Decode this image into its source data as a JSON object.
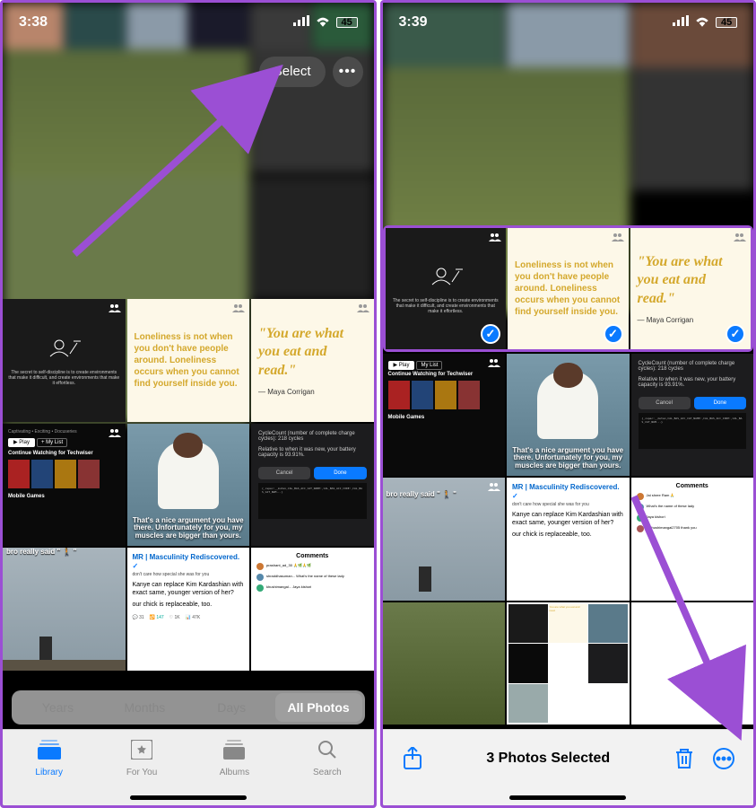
{
  "left": {
    "time": "3:38",
    "battery_level": "45",
    "controls": {
      "select": "Select",
      "more": "•••"
    },
    "quotes": {
      "q1": "Loneliness is not when you don't have people around. Loneliness occurs when you cannot find yourself inside you.",
      "q2": "\"You are what you eat and read.\"",
      "author": "— Maya Corrigan",
      "discipline": "The secret to self-discipline is to create environments that make it difficult, and create environments that make it effortless."
    },
    "cells": {
      "muscle": "That's a nice argument you have there. Unfortunately for you, my muscles are bigger than yours.",
      "cycle_t": "CycleCount (number of complete charge cycles): 218 cycles",
      "cycle_d": "Relative to when it was new, your battery capacity is 93.91%.",
      "cancel": "Cancel",
      "done": "Done",
      "nf_cat": "Captivating • Exciting • Docuseries",
      "nf_play": "▶ Play",
      "nf_mylist": "+ My List",
      "nf_cw": "Continue Watching for Techwiser",
      "nf_mg": "Mobile Games",
      "bro": "bro really said \" 🚶 \"",
      "masc": "MR | Masculinity Rediscovered.",
      "masc1": "don't care how special she was for you",
      "masc2": "Kanye can replace Kim Kardashian with exact same, younger version of her?",
      "masc3": "our chick is replaceable, too.",
      "stat1": "31",
      "stat2": "147",
      "stat3": "1K",
      "stat4": "47K",
      "comments": "Comments"
    },
    "segments": {
      "years": "Years",
      "months": "Months",
      "days": "Days",
      "all": "All Photos"
    },
    "tabs": {
      "library": "Library",
      "foryou": "For You",
      "albums": "Albums",
      "search": "Search"
    }
  },
  "right": {
    "time": "3:39",
    "battery_level": "45",
    "selected_text": "3 Photos Selected",
    "quotes": {
      "q1": "Loneliness is not when you don't have people around. Loneliness occurs when you cannot find yourself inside you.",
      "q2": "\"You are what you eat and read.\"",
      "author": "— Maya Corrigan",
      "discipline": "The secret to self-discipline is to create environments that make it difficult, and create environments that make it effortless."
    },
    "cells": {
      "muscle": "That's a nice argument you have there. Unfortunately for you, my muscles are bigger than yours.",
      "cycle_t": "CycleCount (number of complete charge cycles): 218 cycles",
      "cycle_d": "Relative to when it was new, your battery capacity is 93.91%.",
      "cancel": "Cancel",
      "done": "Done",
      "nf_play": "▶ Play",
      "nf_mylist": "My List",
      "nf_cw": "Continue Watching for Techwiser",
      "nf_mg": "Mobile Games",
      "bro": "bro really said \" 🚶 \"",
      "masc": "MR | Masculinity Rediscovered.",
      "masc1": "don't care how special she was for you",
      "masc2": "Kanye can replace Kim Kardashian with exact same, younger version of her?",
      "masc3": "our chick is replaceable, too.",
      "comments": "Comments"
    }
  }
}
